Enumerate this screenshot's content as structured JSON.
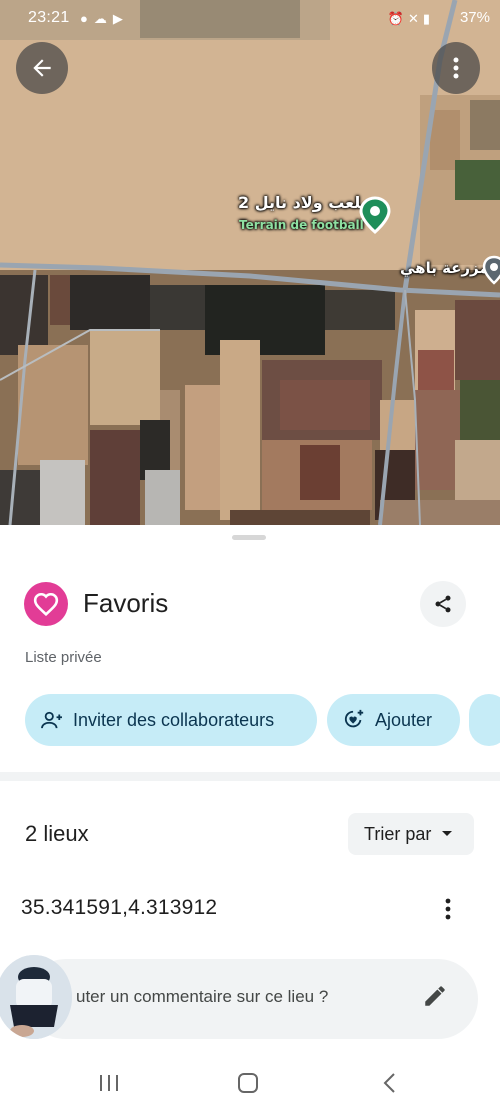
{
  "status_bar": {
    "time": "23:21",
    "left_icons": [
      "messenger-icon",
      "cloud-icon",
      "youtube-icon"
    ],
    "right_icons": [
      "alarm-icon",
      "mute-icon",
      "wifi-icon",
      "signal-icon"
    ],
    "battery": "37%"
  },
  "map": {
    "place_label_ar": "ملعب ولاد نايل 2",
    "place_label_fr": "Terrain de football",
    "farm_label_ar": "مزرعة باهي",
    "colors": {
      "pin": "#1e8e5a",
      "road": "#9aa5b1",
      "land": "#cfb394"
    }
  },
  "list": {
    "title": "Favoris",
    "privacy": "Liste privée",
    "icon": "heart-icon",
    "accent": "#e23c96"
  },
  "actions": {
    "invite_label": "Inviter des collaborateurs",
    "add_label": "Ajouter"
  },
  "places": {
    "count_label": "2 lieux",
    "sort_label": "Trier par",
    "items": [
      {
        "name": "35.341591,4.313912"
      }
    ]
  },
  "comment": {
    "placeholder": "uter un commentaire sur ce lieu ?"
  },
  "navigation": {
    "recent_icon": "recent-apps-icon",
    "home_icon": "home-icon",
    "back_icon": "back-icon"
  }
}
